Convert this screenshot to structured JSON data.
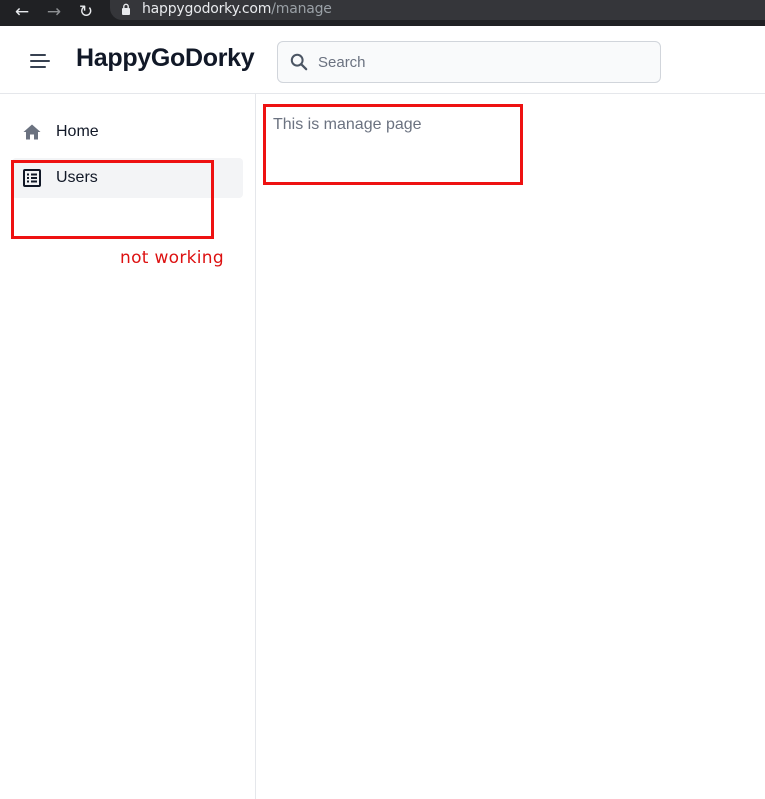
{
  "browser": {
    "url_host": "happygodorky.com",
    "url_path": "/manage"
  },
  "header": {
    "brand": "HappyGoDorky",
    "search": {
      "placeholder": "Search",
      "value": ""
    }
  },
  "sidebar": {
    "items": [
      {
        "label": "Home",
        "icon": "home-icon",
        "active": false
      },
      {
        "label": "Users",
        "icon": "list-icon",
        "active": true
      }
    ]
  },
  "main": {
    "text": "This is manage page"
  },
  "annotation": {
    "note": "not working",
    "color": "#ee1111"
  }
}
